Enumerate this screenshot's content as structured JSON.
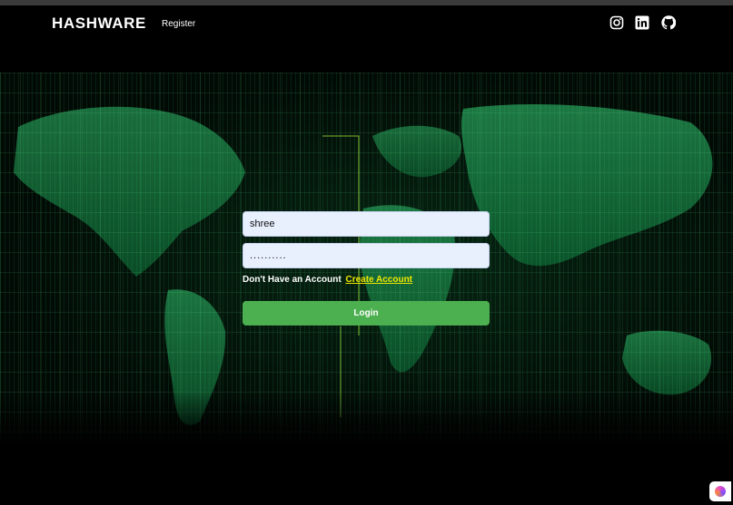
{
  "navbar": {
    "brand": "HASHWARE",
    "links": [
      {
        "label": "Register"
      }
    ],
    "social_icons": [
      "instagram-icon",
      "linkedin-icon",
      "github-icon"
    ]
  },
  "login_form": {
    "username_value": "shree",
    "username_placeholder": "",
    "password_value": "..........",
    "account_prompt": "Don't Have an Account",
    "create_account_link": "Create Account",
    "submit_label": "Login"
  },
  "theme": {
    "background": "#000000",
    "accent_green": "#4caf50",
    "link_yellow": "#f1e800",
    "input_background": "#e8f0fe"
  }
}
